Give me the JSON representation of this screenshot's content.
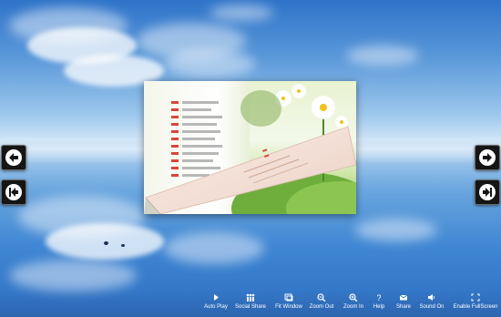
{
  "toolbar": {
    "items": [
      {
        "label": "Auto Play",
        "icon": "play-icon"
      },
      {
        "label": "Social Share",
        "icon": "social-share-icon"
      },
      {
        "label": "Fit Window",
        "icon": "fit-window-icon"
      },
      {
        "label": "Zoom Out",
        "icon": "zoom-out-icon"
      },
      {
        "label": "Zoom In",
        "icon": "zoom-in-icon"
      },
      {
        "label": "Help",
        "icon": "help-icon"
      },
      {
        "label": "Share",
        "icon": "mail-icon"
      },
      {
        "label": "Sound On",
        "icon": "speaker-icon"
      },
      {
        "label": "Enable FullScreen",
        "icon": "fullscreen-icon"
      }
    ]
  },
  "nav": {
    "prev": {
      "icon": "arrow-left-icon"
    },
    "first": {
      "icon": "first-page-icon"
    },
    "next": {
      "icon": "arrow-right-icon"
    },
    "last": {
      "icon": "last-page-icon"
    }
  },
  "colors": {
    "sky_top": "#2f73c9",
    "nav_button": "#151515",
    "toc_number": "#d8453a",
    "flower_core": "#f2c21a"
  }
}
